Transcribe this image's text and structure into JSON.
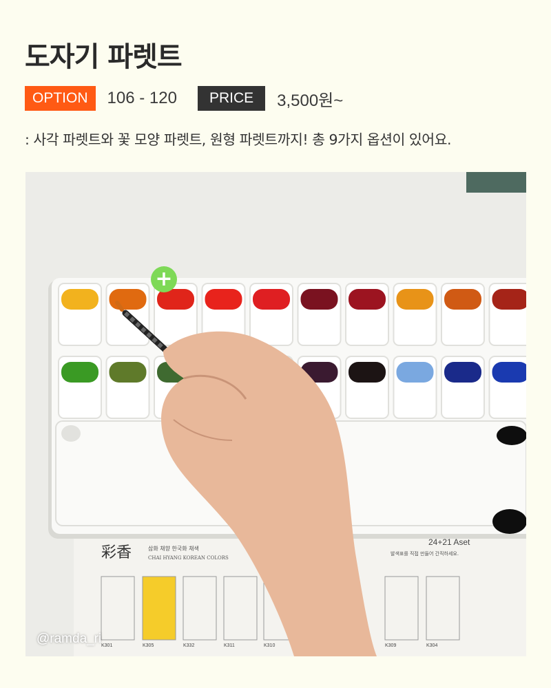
{
  "title": "도자기 파렛트",
  "meta": {
    "option_label": "OPTION",
    "option_value": "106 - 120",
    "price_label": "PRICE",
    "price_value": "3,500원~"
  },
  "description": ": 사각 파렛트와 꽃 모양 파렛트, 원형 파렛트까지! 총 9가지 옵션이 있어요.",
  "photo": {
    "credit": "@ramda_ri",
    "plus_symbol": "+",
    "sheet_heading": "彩香",
    "sheet_subtitle": "CHAI HYANG KOREAN COLORS",
    "sheet_korean": "삼화 채향 한국화 채색",
    "sheet_set": "24+21 Aset",
    "sheet_note": "발색표를 직접 만들어 간직하세요.",
    "swatch_codes": [
      "K301",
      "K305",
      "K332",
      "K311",
      "K310",
      "K309",
      "K304"
    ]
  },
  "colors": {
    "option_badge": "#ff5a14",
    "price_badge": "#333333",
    "background": "#fdfdf0",
    "plus_button": "#7ed957"
  },
  "paint_colors": {
    "row1": [
      "#f2b21e",
      "#e06a10",
      "#e0251a",
      "#e8231c",
      "#df1f22",
      "#7a1220",
      "#9c1420",
      "#e89318",
      "#d05a14",
      "#a52418"
    ],
    "row2": [
      "#3a9a24",
      "#5f7a2a",
      "#3f6a30",
      "#000000",
      "#000000",
      "#3a1a30",
      "#1c1414",
      "#7aa8e0",
      "#1a2a8a",
      "#1a3ab0"
    ]
  }
}
